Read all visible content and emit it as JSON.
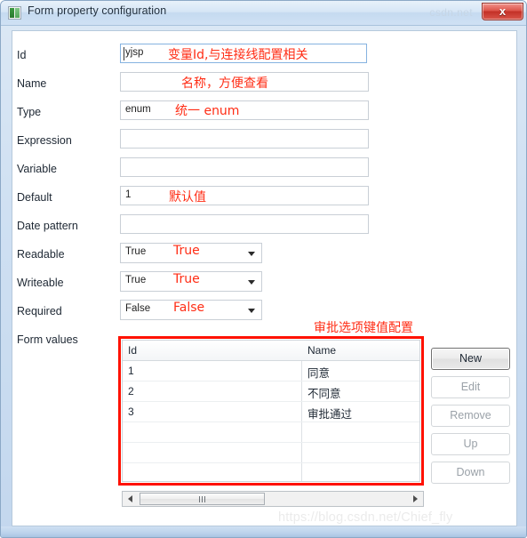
{
  "window": {
    "title": "Form property configuration",
    "icon": "form-icon",
    "close_label": "x",
    "title_watermark": "csdn.net"
  },
  "form": {
    "fields": [
      {
        "label": "Id",
        "value": "yjsp",
        "type": "text",
        "focused": true,
        "annotation": "变量Id,与连接线配置相关"
      },
      {
        "label": "Name",
        "value": "",
        "type": "text",
        "focused": false,
        "annotation": "名称，方便查看"
      },
      {
        "label": "Type",
        "value": "enum",
        "type": "text",
        "focused": false,
        "annotation": "统一  enum"
      },
      {
        "label": "Expression",
        "value": "",
        "type": "text",
        "focused": false,
        "annotation": ""
      },
      {
        "label": "Variable",
        "value": "",
        "type": "text",
        "focused": false,
        "annotation": ""
      },
      {
        "label": "Default",
        "value": "1",
        "type": "text",
        "focused": false,
        "annotation": "默认值"
      },
      {
        "label": "Date pattern",
        "value": "",
        "type": "text",
        "focused": false,
        "annotation": ""
      },
      {
        "label": "Readable",
        "value": "True",
        "type": "combo",
        "focused": false,
        "annotation": "True"
      },
      {
        "label": "Writeable",
        "value": "True",
        "type": "combo",
        "focused": false,
        "annotation": "True"
      },
      {
        "label": "Required",
        "value": "False",
        "type": "combo",
        "focused": false,
        "annotation": "False"
      },
      {
        "label": "Form values",
        "value": "",
        "type": "none",
        "focused": false,
        "annotation": ""
      }
    ]
  },
  "form_values": {
    "annotation": "审批选项键值配置",
    "columns": [
      "Id",
      "Name"
    ],
    "rows": [
      {
        "id": "1",
        "name": "同意"
      },
      {
        "id": "2",
        "name": "不同意"
      },
      {
        "id": "3",
        "name": "审批通过"
      },
      {
        "id": "",
        "name": ""
      },
      {
        "id": "",
        "name": ""
      },
      {
        "id": "",
        "name": ""
      },
      {
        "id": "",
        "name": ""
      },
      {
        "id": "",
        "name": ""
      }
    ],
    "buttons": [
      {
        "label": "New",
        "enabled": true
      },
      {
        "label": "Edit",
        "enabled": false
      },
      {
        "label": "Remove",
        "enabled": false
      },
      {
        "label": "Up",
        "enabled": false
      },
      {
        "label": "Down",
        "enabled": false
      }
    ]
  },
  "watermark": "https://blog.csdn.net/Chief_fly",
  "colors": {
    "annotation": "#ff2d15",
    "table_outline": "#ff1100",
    "title_bar": "#cfe1f4"
  }
}
